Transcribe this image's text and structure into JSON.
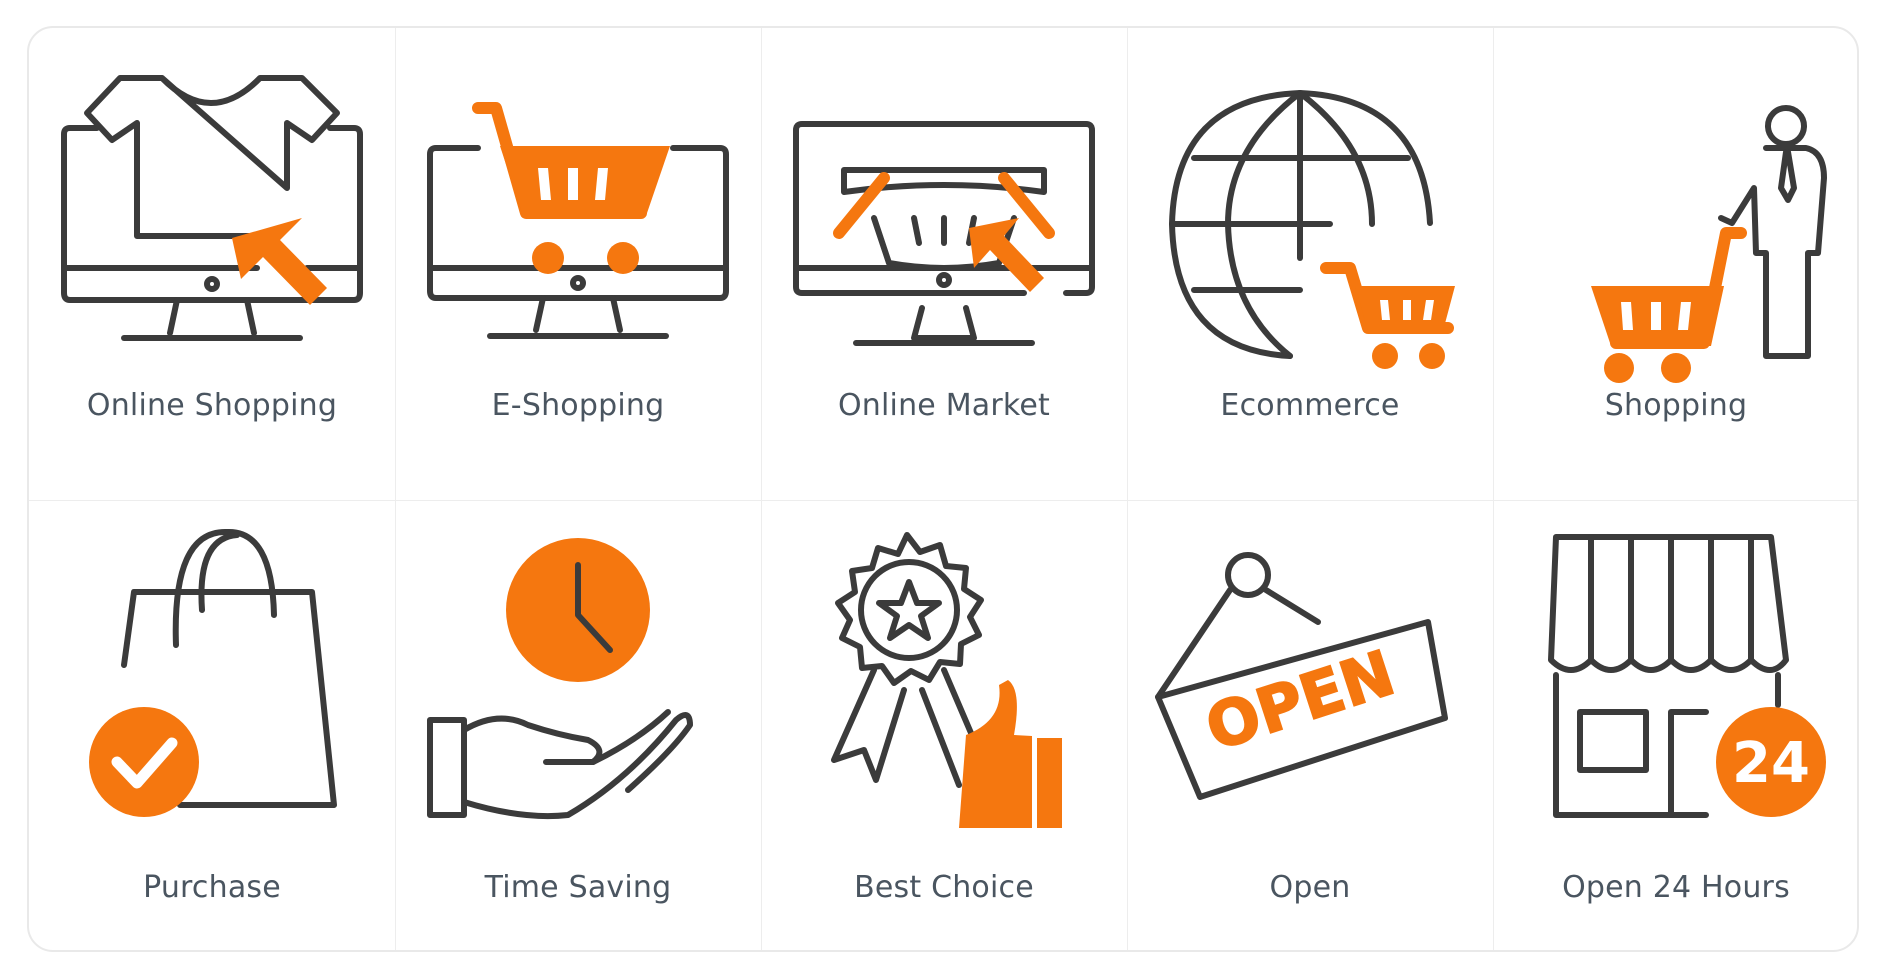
{
  "colors": {
    "accent": "#f5770f",
    "outline": "#3b3b3b",
    "label": "#4a5560"
  },
  "icons": [
    {
      "label": "Online Shopping",
      "icon": "monitor-tshirt-cursor-icon"
    },
    {
      "label": "E-Shopping",
      "icon": "monitor-cart-icon"
    },
    {
      "label": "Online Market",
      "icon": "monitor-basket-cursor-icon"
    },
    {
      "label": "Ecommerce",
      "icon": "globe-cart-icon"
    },
    {
      "label": "Shopping",
      "icon": "person-cart-icon"
    },
    {
      "label": "Purchase",
      "icon": "bag-check-icon"
    },
    {
      "label": "Time Saving",
      "icon": "hand-clock-icon"
    },
    {
      "label": "Best Choice",
      "icon": "badge-thumbs-up-icon"
    },
    {
      "label": "Open",
      "icon": "open-sign-icon",
      "sign_text": "OPEN"
    },
    {
      "label": "Open 24 Hours",
      "icon": "store-24-icon",
      "badge_text": "24"
    }
  ]
}
